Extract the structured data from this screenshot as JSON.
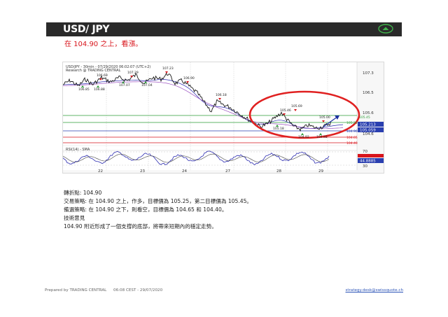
{
  "header": {
    "title": "USD/ JPY",
    "icon": "chevron-up-circle-icon",
    "accent": "#2a2a2a",
    "icon_color": "#3fb24a"
  },
  "headline": "在 104.90 之上，看漲。",
  "chart": {
    "info_line1": "USD/JPY - 30min - 07/29/2020 06:02:07 (UTC+2)",
    "info_line2": "Research @ TRADING CENTRAL",
    "price_labels": [
      "107.3",
      "106.5",
      "105.6",
      "105.213",
      "105.059",
      "104.6"
    ],
    "level_labels": [
      "105.45",
      "105.25",
      "104.90",
      "104.65",
      "104.40"
    ],
    "annotations": [
      {
        "text": "106.85"
      },
      {
        "text": "106.69"
      },
      {
        "text": "106.88"
      },
      {
        "text": "107.07"
      },
      {
        "text": "107.04"
      },
      {
        "text": "107.29"
      },
      {
        "text": "107.23"
      },
      {
        "text": "106.90"
      },
      {
        "text": "106.18"
      },
      {
        "text": "105.46"
      },
      {
        "text": "105.69"
      },
      {
        "text": "105.18"
      },
      {
        "text": "104.92"
      },
      {
        "text": "104.92"
      },
      {
        "text": "105.00"
      }
    ],
    "rsi_label": "RSI(14) - SMA",
    "rsi_ticks": [
      "70",
      "30"
    ],
    "rsi_value": "44.8885",
    "x_ticks": [
      "22",
      "23",
      "24",
      "27",
      "28",
      "29"
    ],
    "colors": {
      "up": "#2a2a2a",
      "level_green": "#2e9e38",
      "level_red": "#d8151c",
      "level_blue": "#2a3fb0",
      "ma": "#2b2bb0",
      "ellipse": "#e02020",
      "arrow": "#1a2fa0"
    }
  },
  "body": {
    "pivot": "轉折點: 104.90",
    "strategy": "交易策略: 在 104.90 之上，作多，目標價為 105.25，第二目標價為 105.45。",
    "alternative": "備選策略: 在 104.90 之下，則看空，目標價為 104.65 和 104.40。",
    "technical_title": "技術意見",
    "technical_text": "104.90 附近形成了一個支撐的底部，將帶來短期內的穩定走勢。"
  },
  "footer": {
    "prepared_by": "Prepared by TRADING CENTRAL",
    "timestamp": "06:08 CEST - 29/07/2020",
    "email": "strategy.desk@swissquote.ch"
  }
}
